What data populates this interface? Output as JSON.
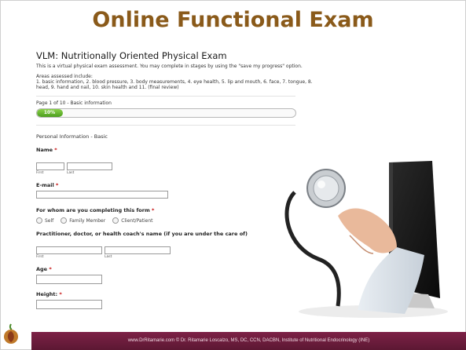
{
  "slide": {
    "title": "Online Functional Exam",
    "footer": "www.DrRitamarie.com     © Dr. Ritamarie Loscalzo, MS, DC, CCN, DACBN, Institute of Nutritional Endocrinology (INE)"
  },
  "form": {
    "title": "VLM: Nutritionally Oriented Physical Exam",
    "intro": "This is a virtual physical exam assessment. You may complete in stages by using the \"save my progress\" option.",
    "areas_heading": "Areas assessed include:",
    "areas_list": "1. basic information, 2. blood pressure, 3. body measurements, 4. eye health, 5. lip and mouth, 6. face, 7. tongue, 8. head, 9. hand and nail, 10. skin health and 11. (final review)",
    "page_label": "Page 1 of 10 - Basic information",
    "progress_text": "10%",
    "progress_fraction": 0.1,
    "section_heading": "Personal Information - Basic",
    "name_label": "Name",
    "first_sub": "First",
    "last_sub": "Last",
    "email_label": "E-mail",
    "whom_label": "For whom are you completing this form",
    "whom_options": [
      "Self",
      "Family Member",
      "Client/Patient"
    ],
    "practitioner_label": "Practitioner, doctor, or health coach's name (if you are under the care of)",
    "age_label": "Age",
    "height_label": "Height:",
    "required_mark": "*"
  }
}
